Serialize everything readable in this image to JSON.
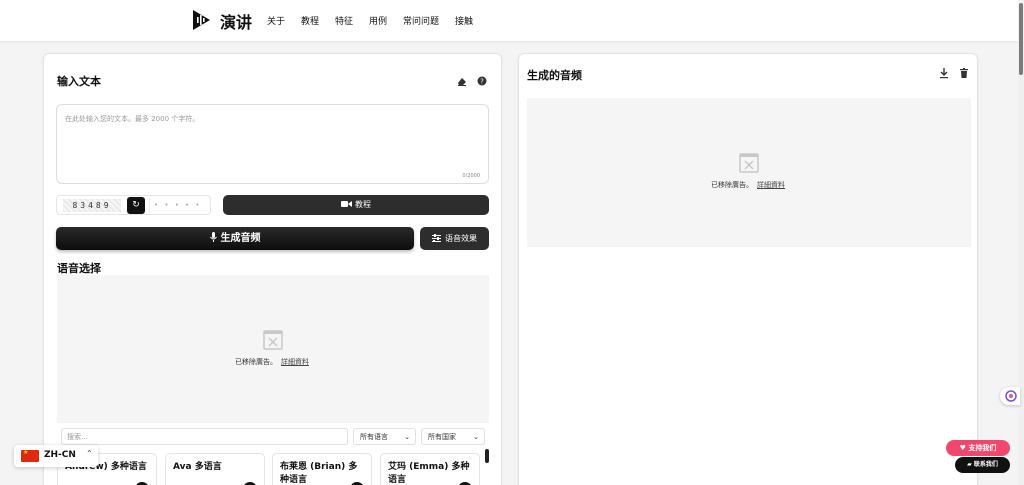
{
  "header": {
    "brand": "演讲",
    "nav": [
      "关于",
      "教程",
      "特征",
      "用例",
      "常问问题",
      "接触"
    ]
  },
  "input_panel": {
    "title": "输入文本",
    "placeholder": "在此处输入您的文本。最多 2000 个字符。",
    "counter": "0/2000",
    "captcha_code": "83489",
    "captcha_placeholder": "• • • • •",
    "tutorial_label": "教程",
    "generate_label": "生成音频",
    "effects_label": "语音效果"
  },
  "voice_section": {
    "title": "语音选择",
    "search_placeholder": "搜索...",
    "language_filter": "所有语言",
    "country_filter": "所有国家",
    "voices": [
      "Andrew) 多种语言",
      "Ava 多语言",
      "布莱恩 (Brian) 多种语言",
      "艾玛 (Emma) 多种语言"
    ]
  },
  "ad": {
    "text": "已移除廣告。",
    "link": "詳細資料"
  },
  "output_panel": {
    "title": "生成的音频"
  },
  "language_switcher": {
    "code": "ZH-CN"
  },
  "floating": {
    "support": "支持我们",
    "contact": "联系我们"
  }
}
